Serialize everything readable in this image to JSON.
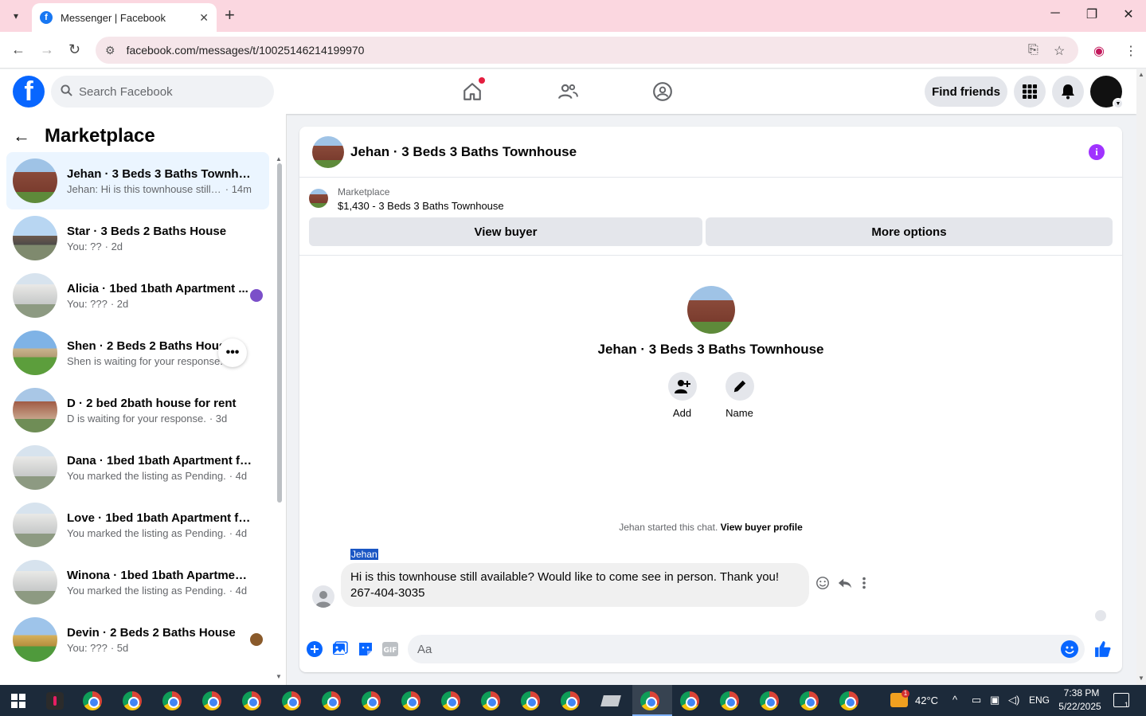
{
  "browser": {
    "tab_title": "Messenger | Facebook",
    "tab_close": "✕",
    "new_tab": "+",
    "url": "facebook.com/messages/t/10025146214199970",
    "window_controls": [
      "─",
      "❐",
      "✕"
    ]
  },
  "fb_header": {
    "logo": "f",
    "search_placeholder": "Search Facebook",
    "find_friends": "Find friends",
    "nav_icons": [
      "home-icon",
      "friends-icon",
      "groups-icon"
    ],
    "right_icons": [
      "menu-grid-icon",
      "bell-icon",
      "account-avatar"
    ]
  },
  "sidebar": {
    "title": "Marketplace",
    "conversations": [
      {
        "name": "Jehan · 3 Beds 3 Baths Townhouse",
        "preview": "Jehan: Hi is this townhouse still a...",
        "time": "· 14m",
        "thumb": "t-brick",
        "active": true
      },
      {
        "name": "Star · 3 Beds 2 Baths House",
        "preview": "You: ??",
        "time": "· 2d",
        "thumb": "t-house"
      },
      {
        "name": "Alicia · 1bed 1bath Apartment ...",
        "preview": "You: ???",
        "time": "· 2d",
        "thumb": "t-apt",
        "badge_color": "#7b4fc9"
      },
      {
        "name": "Shen · 2 Beds 2 Baths House",
        "preview": "Shen is waiting for your response.",
        "time": "",
        "thumb": "t-green",
        "hover_dots": "•••"
      },
      {
        "name": "D · 2 bed 2bath house for rent",
        "preview": "D is waiting for your response.",
        "time": "· 3d",
        "thumb": "t-town"
      },
      {
        "name": "Dana · 1bed 1bath Apartment fo...",
        "preview": "You marked the listing as Pending.",
        "time": "· 4d",
        "thumb": "t-apt"
      },
      {
        "name": "Love · 1bed 1bath Apartment for...",
        "preview": "You marked the listing as Pending.",
        "time": "· 4d",
        "thumb": "t-apt"
      },
      {
        "name": "Winona · 1bed 1bath Apartment ...",
        "preview": "You marked the listing as Pending.",
        "time": "· 4d",
        "thumb": "t-apt"
      },
      {
        "name": "Devin · 2 Beds 2 Baths House",
        "preview": "You: ???",
        "time": "· 5d",
        "thumb": "t-yellow",
        "badge_color": "#8a5a2b"
      }
    ]
  },
  "chat": {
    "header_title": "Jehan · 3 Beds 3 Baths Townhouse",
    "marketplace_label": "Marketplace",
    "listing": "$1,430 - 3 Beds 3 Baths Townhouse",
    "view_buyer": "View buyer",
    "more_options": "More options",
    "card_title": "Jehan · 3 Beds 3 Baths Townhouse",
    "add_label": "Add",
    "name_label": "Name",
    "started_text": "Jehan started this chat.",
    "view_profile": "View buyer profile",
    "sender": "Jehan",
    "message_line1": "Hi is this townhouse still available? Would like to come see in person. Thank you!",
    "message_line2": "267-404-3035",
    "composer_placeholder": "Aa"
  },
  "taskbar": {
    "temperature": "42°C",
    "language": "ENG",
    "time": "7:38 PM",
    "date": "5/22/2025",
    "weather_badge": "1",
    "notif_badge": "1"
  },
  "colors": {
    "fb_blue": "#0866ff",
    "active_conv": "#ebf5ff",
    "tab_bar": "#fbd7e0",
    "info_purple": "#a033ff"
  }
}
